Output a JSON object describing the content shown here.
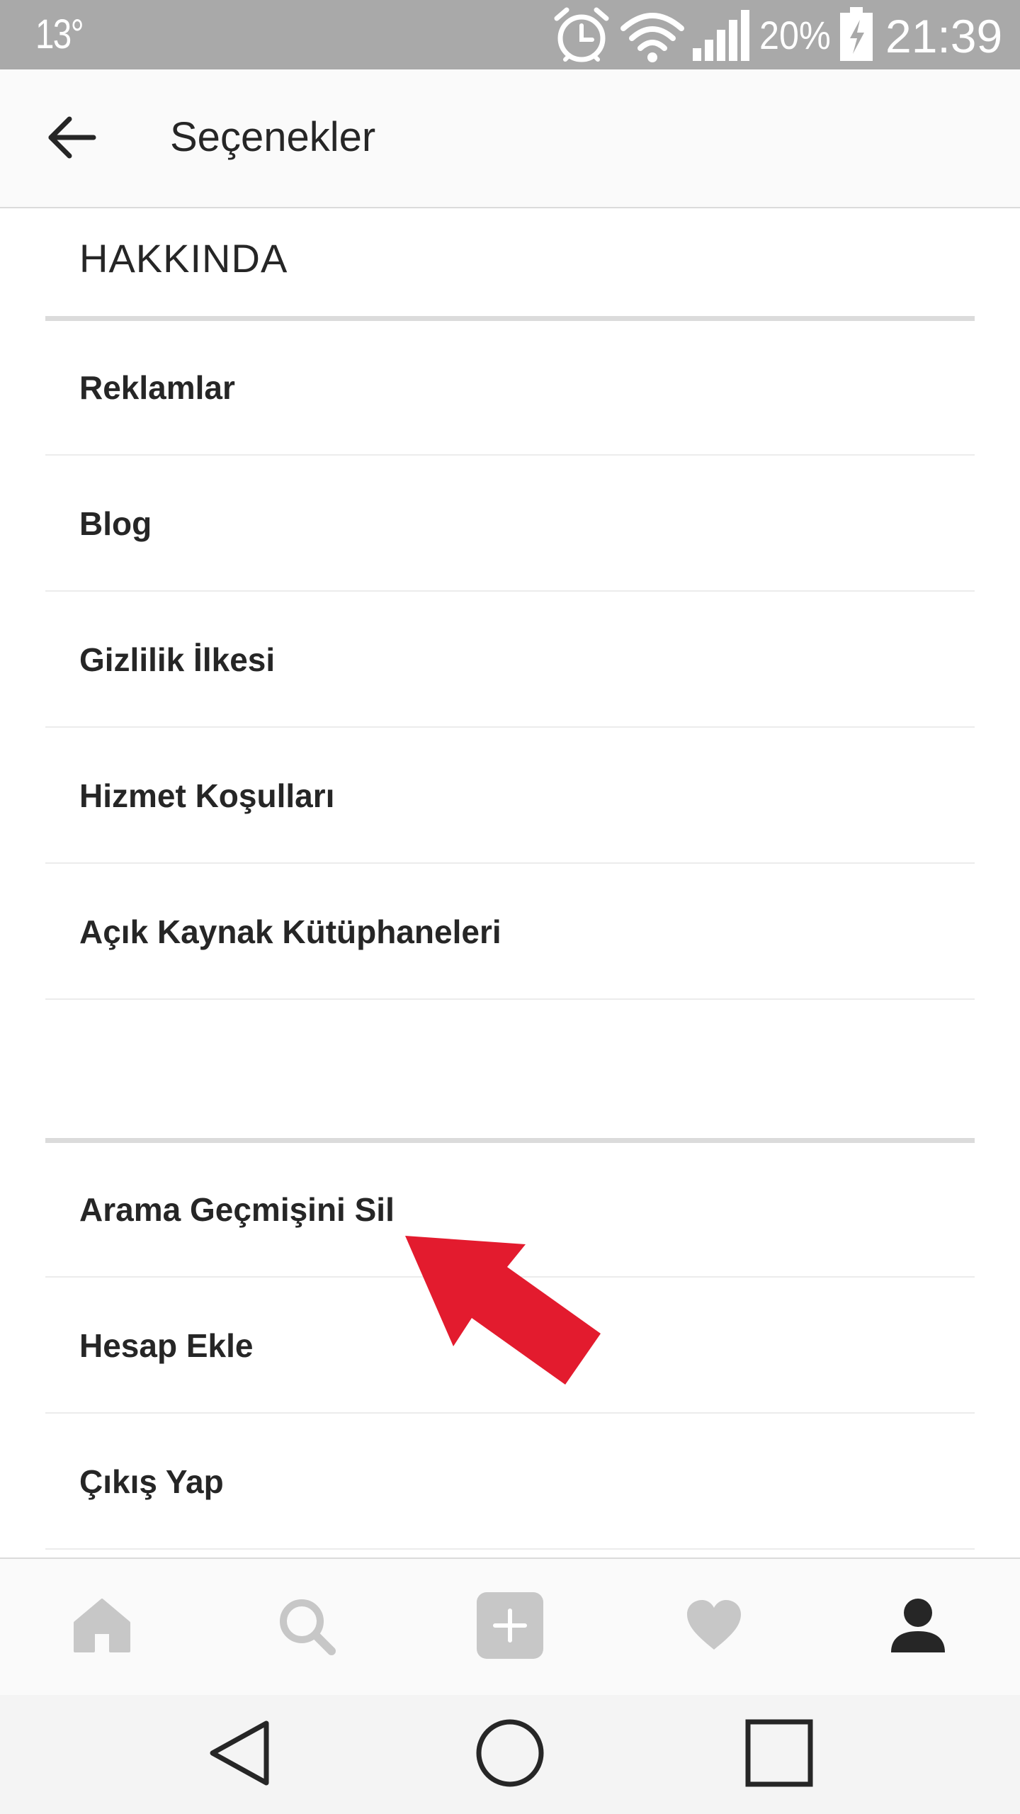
{
  "status_bar": {
    "temperature": "13°",
    "battery_percent": "20%",
    "time": "21:39",
    "icons": [
      "alarm-icon",
      "wifi-icon",
      "signal-icon",
      "battery-charging-icon"
    ]
  },
  "header": {
    "title": "Seçenekler",
    "back_icon": "arrow-left-icon"
  },
  "about_section": {
    "title": "HAKKINDA",
    "items": [
      {
        "label": "Reklamlar"
      },
      {
        "label": "Blog"
      },
      {
        "label": "Gizlilik İlkesi"
      },
      {
        "label": "Hizmet Koşulları"
      },
      {
        "label": "Açık Kaynak Kütüphaneleri"
      }
    ]
  },
  "account_section": {
    "items": [
      {
        "label": "Arama Geçmişini Sil"
      },
      {
        "label": "Hesap Ekle"
      },
      {
        "label": "Çıkış Yap"
      }
    ]
  },
  "annotation": {
    "type": "red-arrow",
    "points_to": "Arama Geçmişini Sil",
    "color": "#e31b2e"
  },
  "tab_bar": {
    "tabs": [
      {
        "icon": "home-icon",
        "active": false
      },
      {
        "icon": "search-icon",
        "active": false
      },
      {
        "icon": "add-post-icon",
        "active": false
      },
      {
        "icon": "heart-icon",
        "active": false
      },
      {
        "icon": "profile-icon",
        "active": true
      }
    ],
    "active_color": "#262626",
    "inactive_color": "#c7c7c7"
  },
  "nav_bar": {
    "buttons": [
      "back-triangle-icon",
      "home-circle-icon",
      "recents-square-icon"
    ]
  },
  "colors": {
    "status_bar_bg": "#a9a9a9",
    "header_bg": "#fafafa",
    "text": "#262626",
    "divider": "#dbdbdb"
  }
}
